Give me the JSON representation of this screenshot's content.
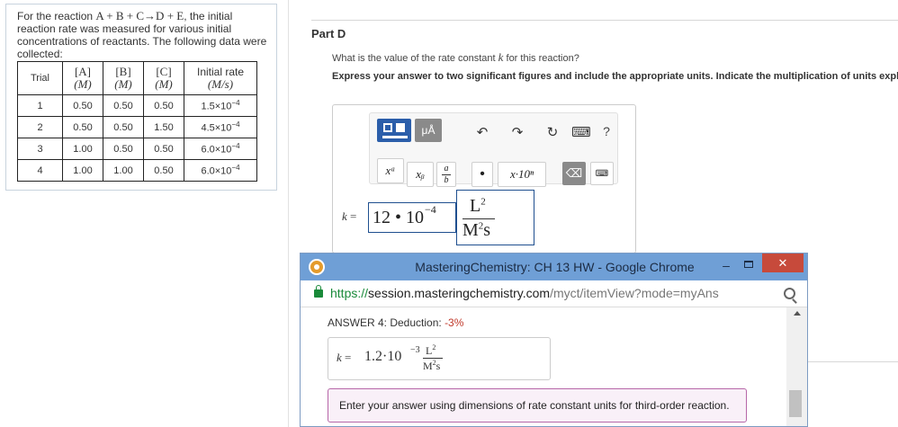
{
  "problem": {
    "intro_prefix": "For the reaction ",
    "reaction": "A + B + C→D + E",
    "intro_suffix": ", the initial reaction rate was measured for various initial concentrations of reactants. The following data were collected:",
    "table": {
      "headers": [
        {
          "top": "Trial",
          "bottom": ""
        },
        {
          "top": "[A]",
          "bottom": "(M)"
        },
        {
          "top": "[B]",
          "bottom": "(M)"
        },
        {
          "top": "[C]",
          "bottom": "(M)"
        },
        {
          "top": "Initial rate",
          "bottom": "(M/s)"
        }
      ],
      "rows": [
        {
          "trial": "1",
          "a": "0.50",
          "b": "0.50",
          "c": "0.50",
          "rate_mant": "1.5×10",
          "rate_exp": "−4"
        },
        {
          "trial": "2",
          "a": "0.50",
          "b": "0.50",
          "c": "1.50",
          "rate_mant": "4.5×10",
          "rate_exp": "−4"
        },
        {
          "trial": "3",
          "a": "1.00",
          "b": "0.50",
          "c": "0.50",
          "rate_mant": "6.0×10",
          "rate_exp": "−4"
        },
        {
          "trial": "4",
          "a": "1.00",
          "b": "1.00",
          "c": "0.50",
          "rate_mant": "6.0×10",
          "rate_exp": "−4"
        }
      ]
    }
  },
  "part": {
    "title": "Part D",
    "question_prefix": "What is the value of the rate constant ",
    "question_var": "k",
    "question_suffix": " for this reaction?",
    "instructions": "Express your answer to two significant figures and include the appropriate units. Indicate the multiplication of units explicitly either with a multiplication dot or a dash."
  },
  "toolbar": {
    "units_label": "μÅ",
    "undo_glyph": "↶",
    "redo_glyph": "↷",
    "reset_glyph": "↻",
    "keyboard_glyph": "⌨",
    "help_label": "?",
    "power_label": "xᵃ",
    "subscript_label": "xᵦ",
    "fraction_top": "a",
    "fraction_bottom": "b",
    "dot_label": "•",
    "sci_label": "x·10ⁿ",
    "backspace_glyph": "⌫",
    "keyboard2_glyph": "⌨"
  },
  "answer_input": {
    "label_var": "k",
    "label_eq": " = ",
    "value": "12 • 10",
    "value_exp": "−4",
    "unit_num": "L",
    "unit_num_exp": "2",
    "unit_den_base": "M",
    "unit_den_exp": "2",
    "unit_den_tail": "s"
  },
  "popup": {
    "title": "MasteringChemistry: CH 13 HW - Google Chrome",
    "minimize": "–",
    "close": "✕",
    "url_scheme": "https://",
    "url_host": "session.masteringchemistry.com",
    "url_path": "/myct/itemView?mode=myAns",
    "answer_heading": "ANSWER 4: Deduction: ",
    "deduction": "-3%",
    "answer_k": "k",
    "answer_eq": " = ",
    "answer_value": "1.2·10",
    "answer_exp": "−3",
    "answer_unit_num": "L",
    "answer_unit_num_exp": "2",
    "answer_unit_den_base": "M",
    "answer_unit_den_exp": "2",
    "answer_unit_den_tail": "s",
    "feedback": "Enter your answer using dimensions of rate constant units for third-order reaction."
  },
  "colors": {
    "accent_blue": "#2b5eaa",
    "titlebar": "#6f9fd6",
    "close_red": "#c74a3b",
    "feedback_border": "#b667a8",
    "deduction_red": "#c0392b",
    "secure_green": "#1a8a3a"
  }
}
